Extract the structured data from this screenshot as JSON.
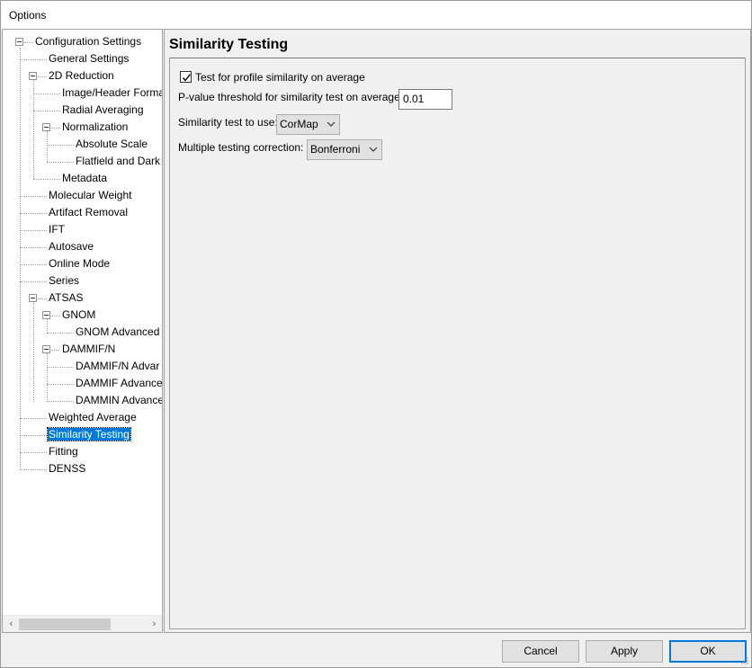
{
  "window": {
    "title": "Options"
  },
  "tree": {
    "root": "Configuration Settings",
    "items": {
      "general": "General Settings",
      "reduction2d": "2D Reduction",
      "image_header": "Image/Header Forma",
      "radial": "Radial Averaging",
      "normalization": "Normalization",
      "absolute_scale": "Absolute Scale",
      "flatfield": "Flatfield and Dark",
      "metadata": "Metadata",
      "mol_weight": "Molecular Weight",
      "artifact": "Artifact Removal",
      "ift": "IFT",
      "autosave": "Autosave",
      "online": "Online Mode",
      "series": "Series",
      "atsas": "ATSAS",
      "gnom": "GNOM",
      "gnom_adv": "GNOM Advanced",
      "dammifn": "DAMMIF/N",
      "dammifn_adv": "DAMMIF/N Advar",
      "dammif_adv": "DAMMIF Advance",
      "dammin_adv": "DAMMIN Advance",
      "weighted": "Weighted Average",
      "similarity": "Similarity Testing",
      "fitting": "Fitting",
      "denss": "DENSS"
    },
    "selected": "Similarity Testing"
  },
  "panel": {
    "title": "Similarity Testing",
    "test_profile_label": "Test for profile similarity on average",
    "test_profile_checked": true,
    "pvalue_label": "P-value threshold for similarity test on average",
    "pvalue_value": "0.01",
    "test_to_use_label": "Similarity test to use:",
    "test_to_use_value": "CorMap",
    "correction_label": "Multiple testing correction:",
    "correction_value": "Bonferroni"
  },
  "buttons": {
    "cancel": "Cancel",
    "apply": "Apply",
    "ok": "OK"
  },
  "colors": {
    "selection": "#0078d7",
    "default_button_border": "#0078d7"
  }
}
